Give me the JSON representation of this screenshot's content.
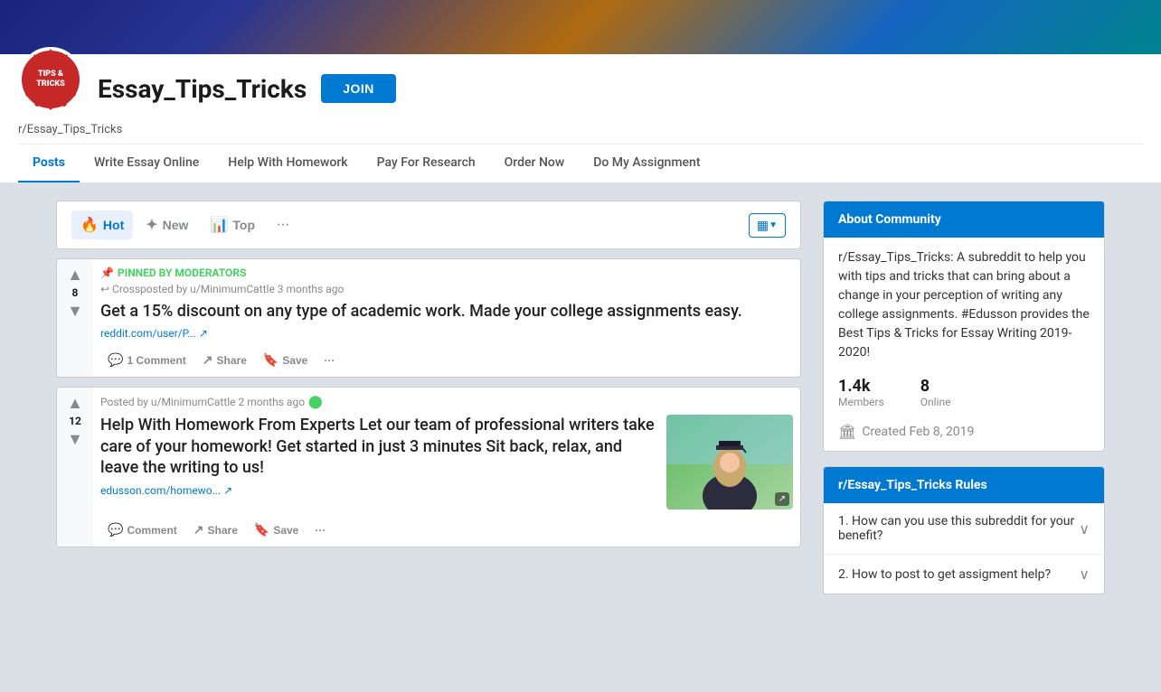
{
  "header": {
    "banner_gradient": "linear-gradient(135deg, #1a237e 0%, #283593 20%, #b06a10 50%, #1565c0 75%, #00838f 100%)",
    "logo_line1": "TIPS &",
    "logo_line2": "TRICKS",
    "subreddit_name": "Essay_Tips_Tricks",
    "subreddit_handle": "r/Essay_Tips_Tricks",
    "join_label": "JOIN"
  },
  "nav": {
    "tabs": [
      {
        "label": "Posts",
        "active": true
      },
      {
        "label": "Write Essay Online",
        "active": false
      },
      {
        "label": "Help With Homework",
        "active": false
      },
      {
        "label": "Pay For Research",
        "active": false
      },
      {
        "label": "Order Now",
        "active": false
      },
      {
        "label": "Do My Assignment",
        "active": false
      }
    ]
  },
  "sort_bar": {
    "hot_label": "Hot",
    "new_label": "New",
    "top_label": "Top",
    "more": "...",
    "view_icon": "▦"
  },
  "posts": [
    {
      "pinned": true,
      "pinned_label": "PINNED BY MODERATORS",
      "crosspost_label": "Crossposted by u/MinimumCattle 3 months ago",
      "vote_count": "8",
      "title": "Get a 15% discount on any type of academic work. Made your college assignments easy.",
      "link_text": "reddit.com/user/P...",
      "link_icon": "🔗",
      "comment_count": "1 Comment",
      "actions": [
        "1 Comment",
        "Share",
        "Save",
        "..."
      ]
    },
    {
      "pinned": false,
      "posted_by": "Posted by u/MinimumCattle 2 months ago",
      "green_dot": true,
      "vote_count": "12",
      "title": "Help With Homework From Experts Let our team of professional writers take care of your homework! Get started in just 3 minutes Sit back, relax, and leave the writing to us!",
      "link_text": "edusson.com/homewo...",
      "link_icon": "🔗",
      "has_image": true,
      "actions": [
        "Comment",
        "Share",
        "Save",
        "..."
      ]
    }
  ],
  "sidebar": {
    "about": {
      "header": "About Community",
      "description": "r/Essay_Tips_Tricks: A subreddit to help you with tips and tricks that can bring about a change in your perception of writing any college assignments. #Edusson provides the Best Tips & Tricks for Essay Writing 2019-2020!",
      "members_count": "1.4k",
      "members_label": "Members",
      "online_count": "8",
      "online_label": "Online",
      "created_label": "Created Feb 8, 2019",
      "created_icon": "🏛"
    },
    "rules": {
      "header": "r/Essay_Tips_Tricks Rules",
      "items": [
        {
          "label": "1. How can you use this subreddit for your benefit?"
        },
        {
          "label": "2. How to post to get assigment help?"
        }
      ]
    }
  }
}
